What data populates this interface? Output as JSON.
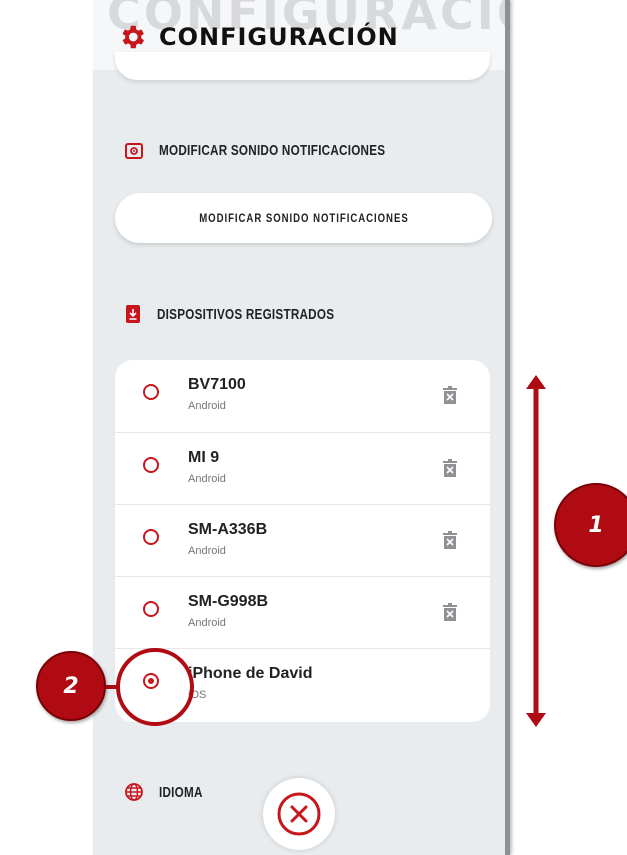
{
  "header": {
    "ghost_text": "CONFIGURACIÓN",
    "title": "CONFIGURACIÓN",
    "icon": "gear-icon"
  },
  "sound_section": {
    "label": "MODIFICAR SONIDO NOTIFICACIONES",
    "icon": "speaker-icon",
    "button_label": "MODIFICAR SONIDO NOTIFICACIONES"
  },
  "devices_section": {
    "label": "DISPOSITIVOS REGISTRADOS",
    "icon": "device-download-icon",
    "items": [
      {
        "name": "BV7100",
        "os": "Android",
        "selected": false
      },
      {
        "name": "MI 9",
        "os": "Android",
        "selected": false
      },
      {
        "name": "SM-A336B",
        "os": "Android",
        "selected": false
      },
      {
        "name": "SM-G998B",
        "os": "Android",
        "selected": false
      },
      {
        "name": "iPhone de David",
        "os": "iOS",
        "selected": true
      }
    ]
  },
  "language_section": {
    "label": "IDIOMA",
    "icon": "globe-icon"
  },
  "annotations": {
    "badge1": "1",
    "badge2": "2"
  },
  "colors": {
    "accent": "#c8161d",
    "annotation": "#b00b12",
    "panel_bg": "#e9ecee"
  }
}
